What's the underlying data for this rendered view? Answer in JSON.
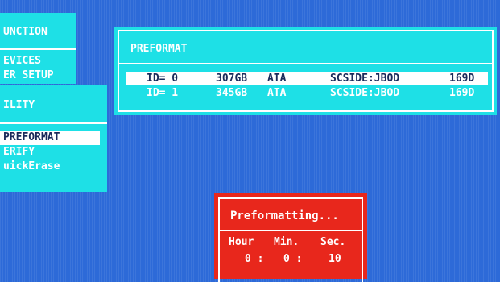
{
  "function_panel": {
    "title": "UNCTION",
    "items": [
      "EVICES",
      "ER SETUP"
    ]
  },
  "utility_panel": {
    "title": "ILITY",
    "items": [
      "PREFORMAT",
      "ERIFY",
      "uickErase"
    ],
    "selected_index": 0
  },
  "preformat_panel": {
    "title": "PREFORMAT",
    "rows": [
      {
        "id": "ID= 0",
        "size": "307GB",
        "type": "ATA",
        "mode": "SCSIDE:JBOD",
        "end": "169D"
      },
      {
        "id": "ID= 1",
        "size": "345GB",
        "type": "ATA",
        "mode": "SCSIDE:JBOD",
        "end": "169D"
      }
    ],
    "selected_index": 0
  },
  "status_dialog": {
    "message": "Preformatting...",
    "labels": {
      "hour": "Hour",
      "min": "Min.",
      "sec": "Sec."
    },
    "values": {
      "hour": "0 :",
      "min": "0 :",
      "sec": "10"
    }
  },
  "colors": {
    "background": "#2d6ad8",
    "panel": "#1ee0e6",
    "dialog": "#e8271c",
    "text": "#ffffff",
    "selected_text": "#1a2a5a"
  }
}
